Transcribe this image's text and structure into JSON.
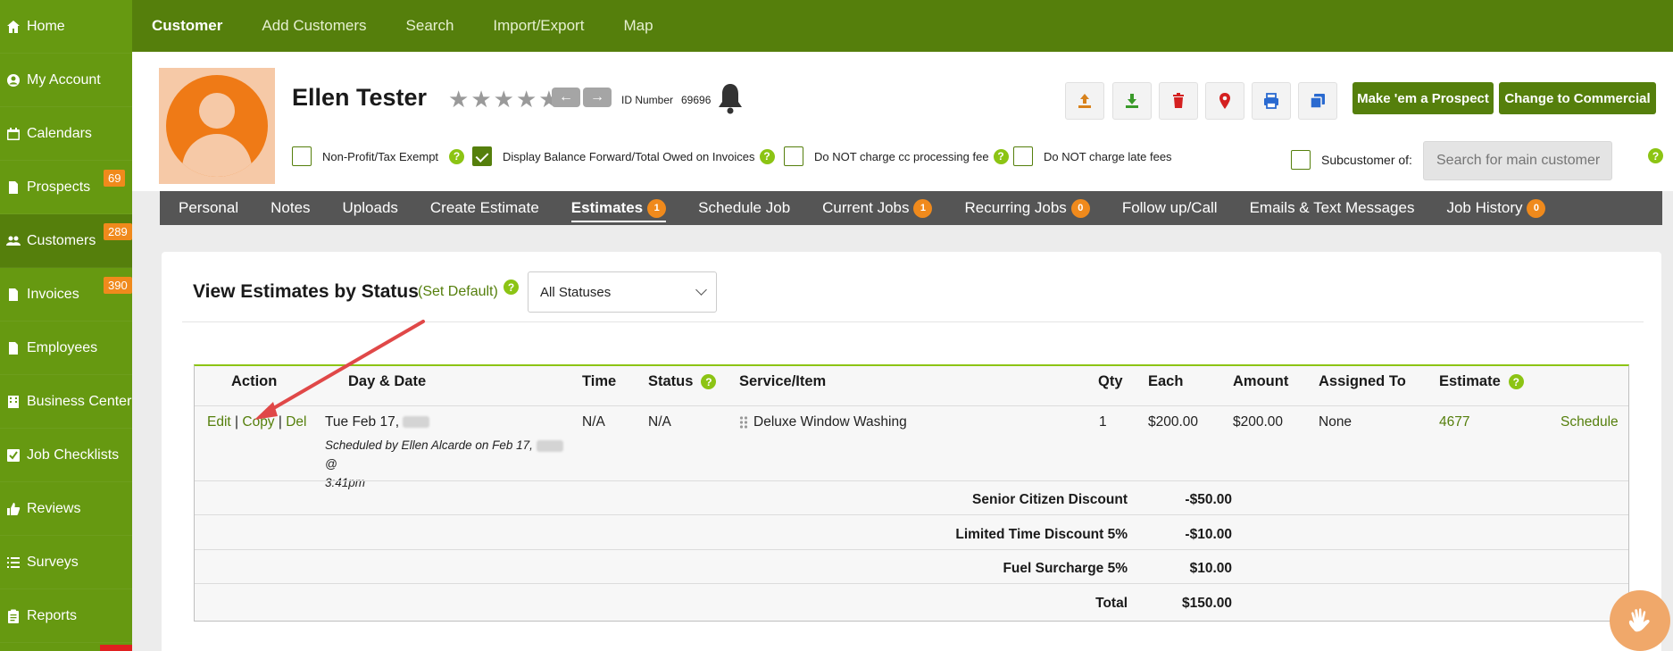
{
  "sidebar": {
    "items": [
      {
        "label": "Home",
        "icon": "home-icon"
      },
      {
        "label": "My Account",
        "icon": "user-circle-icon"
      },
      {
        "label": "Calendars",
        "icon": "calendar-icon"
      },
      {
        "label": "Prospects",
        "icon": "document-icon",
        "badge": "69"
      },
      {
        "label": "Customers",
        "icon": "users-icon",
        "badge": "289"
      },
      {
        "label": "Invoices",
        "icon": "document-icon",
        "badge": "390"
      },
      {
        "label": "Employees",
        "icon": "document-icon"
      },
      {
        "label": "Business Center",
        "icon": "building-icon"
      },
      {
        "label": "Job Checklists",
        "icon": "checkbox-icon"
      },
      {
        "label": "Reviews",
        "icon": "thumbs-up-icon"
      },
      {
        "label": "Surveys",
        "icon": "list-icon"
      },
      {
        "label": "Reports",
        "icon": "clipboard-icon"
      }
    ]
  },
  "topnav": {
    "tabs": [
      "Customer",
      "Add Customers",
      "Search",
      "Import/Export",
      "Map"
    ]
  },
  "customer": {
    "name": "Ellen Tester",
    "id_label": "ID Number",
    "id_value": "69696",
    "rating": 0
  },
  "actions": {
    "prospect_label": "Make 'em a Prospect",
    "commercial_label": "Change to Commercial"
  },
  "options": {
    "nonprofit": "Non-Profit/Tax Exempt",
    "balance_forward": "Display Balance Forward/Total Owed on Invoices",
    "no_cc_fee": "Do NOT charge cc processing fee",
    "no_late_fee": "Do NOT charge late fees",
    "subcustomer_label": "Subcustomer of:",
    "subcustomer_placeholder": "Search for main customer"
  },
  "subtabs": [
    {
      "label": "Personal"
    },
    {
      "label": "Notes"
    },
    {
      "label": "Uploads"
    },
    {
      "label": "Create Estimate"
    },
    {
      "label": "Estimates",
      "badge": "1"
    },
    {
      "label": "Schedule Job"
    },
    {
      "label": "Current Jobs",
      "badge": "1"
    },
    {
      "label": "Recurring Jobs",
      "badge": "0"
    },
    {
      "label": "Follow up/Call"
    },
    {
      "label": "Emails & Text Messages"
    },
    {
      "label": "Job History",
      "badge": "0"
    }
  ],
  "estimates": {
    "title": "View Estimates by Status",
    "set_default": "(Set Default)",
    "status_filter": "All Statuses",
    "headers": {
      "action": "Action",
      "day_date": "Day & Date",
      "time": "Time",
      "status": "Status",
      "service": "Service/Item",
      "qty": "Qty",
      "each": "Each",
      "amount": "Amount",
      "assigned": "Assigned To",
      "estimate": "Estimate"
    },
    "row": {
      "edit": "Edit",
      "copy": "Copy",
      "del": "Del",
      "sep": "|",
      "date": "Tue Feb 17,",
      "scheduled_by": "Scheduled by Ellen Alcarde on Feb 17,",
      "scheduled_at": "@",
      "scheduled_time": "3:41pm",
      "time": "N/A",
      "status": "N/A",
      "service": "Deluxe Window Washing",
      "qty": "1",
      "each": "$200.00",
      "amount": "$200.00",
      "assigned": "None",
      "estimate_no": "4677",
      "schedule": "Schedule"
    },
    "summary": [
      {
        "label": "Senior Citizen Discount",
        "value": "-$50.00"
      },
      {
        "label": "Limited Time Discount 5%",
        "value": "-$10.00"
      },
      {
        "label": "Fuel Surcharge 5%",
        "value": "$10.00"
      },
      {
        "label": "Total",
        "value": "$150.00"
      }
    ]
  },
  "colors": {
    "brand_green": "#557f0c",
    "sidebar_green": "#669911",
    "badge_orange": "#f08a1c",
    "help_green": "#8cc414",
    "annotation_red": "#e04848"
  }
}
